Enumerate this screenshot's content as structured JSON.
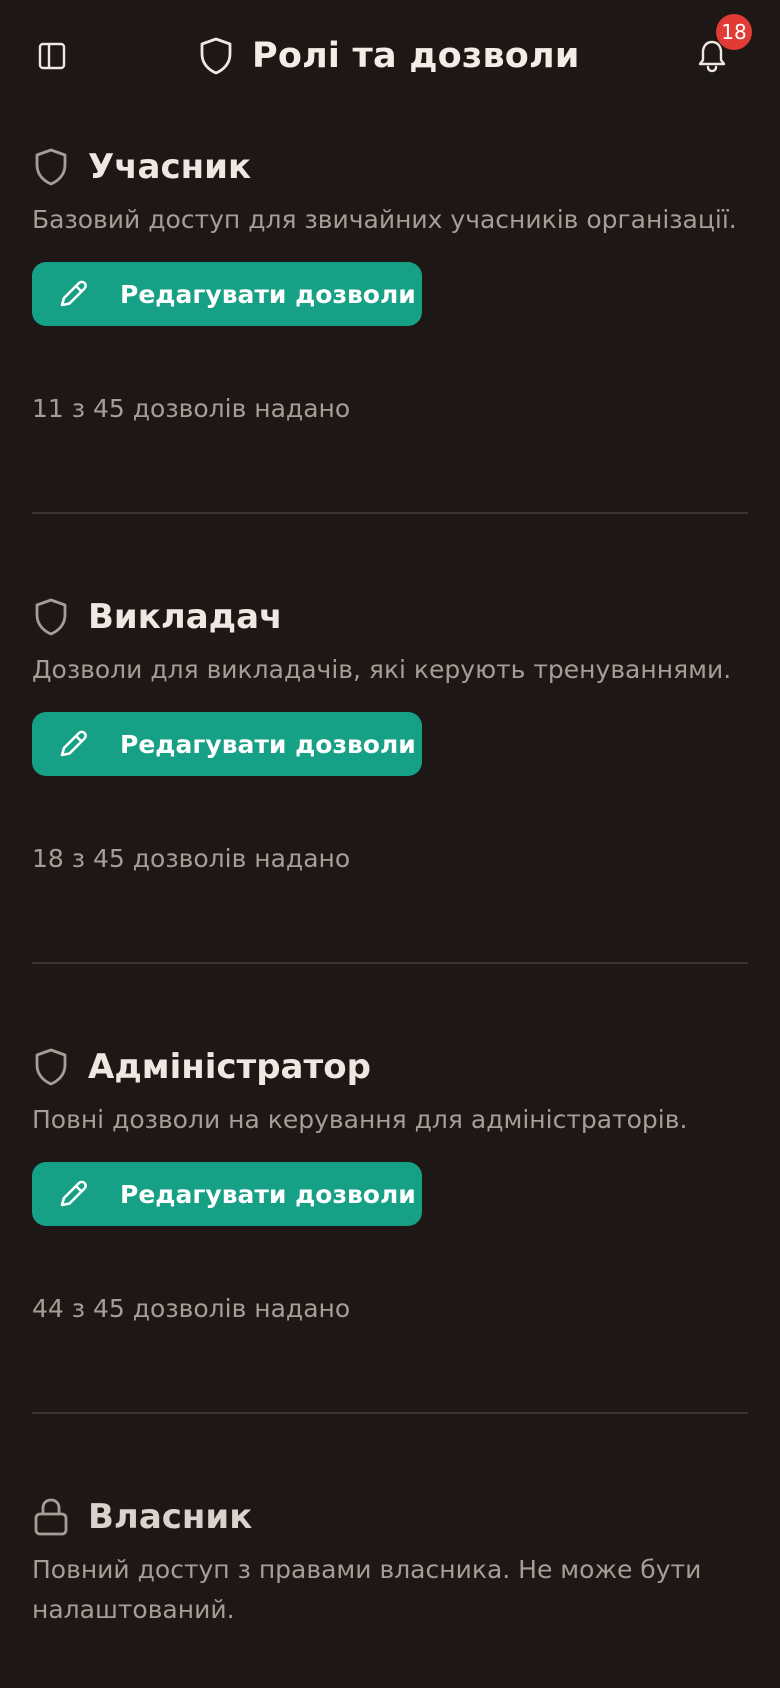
{
  "header": {
    "title": "Ролі та дозволи",
    "notifications_count": "18"
  },
  "roles": [
    {
      "name": "Учасник",
      "description": "Базовий доступ для звичайних учасників організації.",
      "edit_label": "Редагувати дозволи",
      "count_text": "11 з 45 дозволів надано",
      "icon": "shield-icon"
    },
    {
      "name": "Викладач",
      "description": "Дозволи для викладачів, які керують тренуваннями.",
      "edit_label": "Редагувати дозволи",
      "count_text": "18 з 45 дозволів надано",
      "icon": "shield-icon"
    },
    {
      "name": "Адміністратор",
      "description": "Повні дозволи на керування для адміністраторів.",
      "edit_label": "Редагувати дозволи",
      "count_text": "44 з 45 дозволів надано",
      "icon": "shield-icon"
    },
    {
      "name": "Власник",
      "description": "Повний доступ з правами власника. Не може бути налаштований.",
      "icon": "lock-icon"
    }
  ],
  "colors": {
    "background": "#1d1816",
    "accent": "#16a085",
    "badge": "#e23a35",
    "text_primary": "#efe7e2",
    "text_muted": "#a69d97",
    "divider": "#3a3330"
  }
}
